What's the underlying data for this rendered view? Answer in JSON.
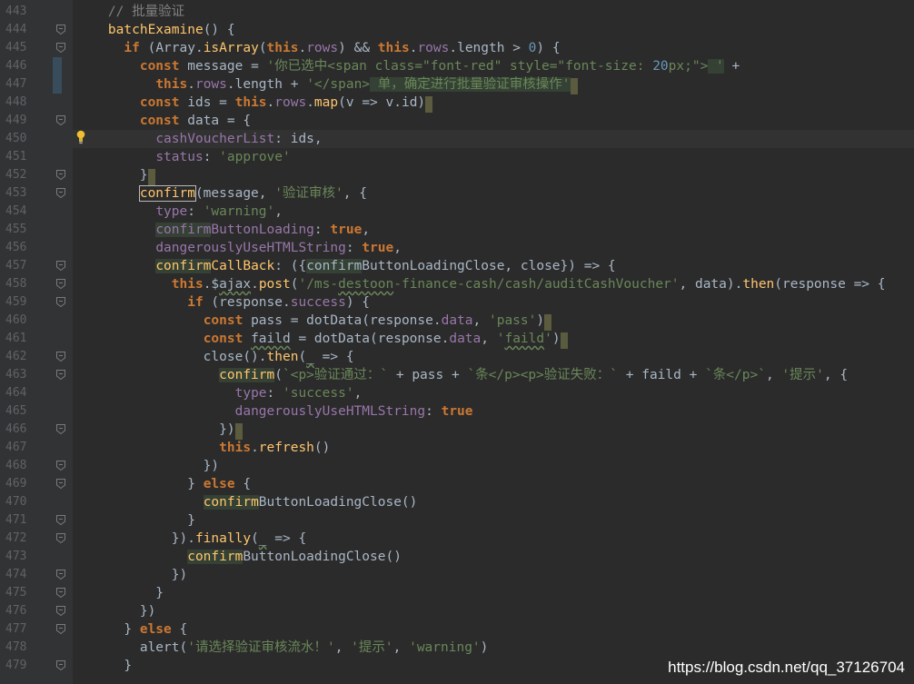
{
  "theme": {
    "background": "#2b2b2b",
    "gutter": "#313335",
    "keyword": "#cc7832",
    "string": "#6a8759",
    "function": "#ffc66d",
    "property": "#9876aa",
    "number": "#6897bb",
    "comment": "#808080",
    "text": "#a9b7c6"
  },
  "editor": {
    "current_line_index": 7,
    "lines": [
      {
        "num": "443",
        "fold": false,
        "tokens": [
          {
            "t": "    "
          },
          {
            "t": "// 批量验证",
            "c": "comment"
          }
        ]
      },
      {
        "num": "444",
        "fold": true,
        "tokens": [
          {
            "t": "    "
          },
          {
            "t": "batchExamine",
            "c": "fn"
          },
          {
            "t": "() {"
          }
        ]
      },
      {
        "num": "445",
        "fold": true,
        "tokens": [
          {
            "t": "      "
          },
          {
            "t": "if",
            "c": "kw"
          },
          {
            "t": " (Array."
          },
          {
            "t": "isArray",
            "c": "fn"
          },
          {
            "t": "("
          },
          {
            "t": "this",
            "c": "kw"
          },
          {
            "t": "."
          },
          {
            "t": "rows",
            "c": "prop"
          },
          {
            "t": ") && "
          },
          {
            "t": "this",
            "c": "kw"
          },
          {
            "t": "."
          },
          {
            "t": "rows",
            "c": "prop"
          },
          {
            "t": ".length > "
          },
          {
            "t": "0",
            "c": "num"
          },
          {
            "t": ") {"
          }
        ]
      },
      {
        "num": "446",
        "fold": false,
        "tokens": [
          {
            "t": "        "
          },
          {
            "t": "const",
            "c": "kw"
          },
          {
            "t": " message = "
          },
          {
            "t": "'你已选中<span class=\"font-red\" style=\"font-size: ",
            "c": "str"
          },
          {
            "t": "20",
            "c": "num"
          },
          {
            "t": "px;\">",
            "c": "str"
          },
          {
            "t": " '",
            "c": "str",
            "hl": true
          },
          {
            "t": " +"
          }
        ]
      },
      {
        "num": "447",
        "fold": false,
        "tokens": [
          {
            "t": "          "
          },
          {
            "t": "this",
            "c": "kw"
          },
          {
            "t": "."
          },
          {
            "t": "rows",
            "c": "prop"
          },
          {
            "t": ".length + "
          },
          {
            "t": "'</span>",
            "c": "str"
          },
          {
            "t": " 单，确定进行批量验证审核操作'",
            "c": "str",
            "hl": true
          },
          {
            "t": " ",
            "caret": true
          }
        ]
      },
      {
        "num": "448",
        "fold": false,
        "tokens": [
          {
            "t": "        "
          },
          {
            "t": "const",
            "c": "kw"
          },
          {
            "t": " ids = "
          },
          {
            "t": "this",
            "c": "kw"
          },
          {
            "t": "."
          },
          {
            "t": "rows",
            "c": "prop"
          },
          {
            "t": "."
          },
          {
            "t": "map",
            "c": "fn"
          },
          {
            "t": "(v => v.id)"
          },
          {
            "t": " ",
            "caret": true
          }
        ]
      },
      {
        "num": "449",
        "fold": true,
        "tokens": [
          {
            "t": "        "
          },
          {
            "t": "const",
            "c": "kw"
          },
          {
            "t": " data = {"
          }
        ]
      },
      {
        "num": "450",
        "fold": false,
        "bulb": true,
        "tokens": [
          {
            "t": "          "
          },
          {
            "t": "cashVoucherList",
            "c": "prop"
          },
          {
            "t": ": ids,"
          }
        ]
      },
      {
        "num": "451",
        "fold": false,
        "tokens": [
          {
            "t": "          "
          },
          {
            "t": "status",
            "c": "prop"
          },
          {
            "t": ": "
          },
          {
            "t": "'approve'",
            "c": "str"
          }
        ]
      },
      {
        "num": "452",
        "fold": true,
        "tokens": [
          {
            "t": "        }"
          },
          {
            "t": " ",
            "caret": true
          }
        ]
      },
      {
        "num": "453",
        "fold": true,
        "tokens": [
          {
            "t": "        "
          },
          {
            "t": "confirm",
            "c": "fn",
            "box": true
          },
          {
            "t": "(message, "
          },
          {
            "t": "'验证审核'",
            "c": "str"
          },
          {
            "t": ", {"
          }
        ]
      },
      {
        "num": "454",
        "fold": false,
        "tokens": [
          {
            "t": "          "
          },
          {
            "t": "type",
            "c": "prop"
          },
          {
            "t": ": "
          },
          {
            "t": "'warning'",
            "c": "str"
          },
          {
            "t": ","
          }
        ]
      },
      {
        "num": "455",
        "fold": false,
        "tokens": [
          {
            "t": "          "
          },
          {
            "t": "confirm",
            "c": "prop",
            "hl": true
          },
          {
            "t": "ButtonLoading",
            "c": "prop"
          },
          {
            "t": ": "
          },
          {
            "t": "true",
            "c": "kw"
          },
          {
            "t": ","
          }
        ]
      },
      {
        "num": "456",
        "fold": false,
        "tokens": [
          {
            "t": "          "
          },
          {
            "t": "dangerouslyUseHTMLString",
            "c": "prop"
          },
          {
            "t": ": "
          },
          {
            "t": "true",
            "c": "kw"
          },
          {
            "t": ","
          }
        ]
      },
      {
        "num": "457",
        "fold": true,
        "tokens": [
          {
            "t": "          "
          },
          {
            "t": "confirm",
            "c": "fn",
            "hl": true
          },
          {
            "t": "CallBack",
            "c": "fn"
          },
          {
            "t": ": ({"
          },
          {
            "t": "confirm",
            "hl": true
          },
          {
            "t": "ButtonLoadingClose, close}) => {"
          }
        ]
      },
      {
        "num": "458",
        "fold": true,
        "tokens": [
          {
            "t": "            "
          },
          {
            "t": "this",
            "c": "kw"
          },
          {
            "t": ".$"
          },
          {
            "t": "ajax",
            "squig": true
          },
          {
            "t": "."
          },
          {
            "t": "post",
            "c": "fn"
          },
          {
            "t": "("
          },
          {
            "t": "'/ms-",
            "c": "str"
          },
          {
            "t": "destoon",
            "c": "str",
            "squig": true
          },
          {
            "t": "-finance-cash/cash/auditCashVoucher'",
            "c": "str"
          },
          {
            "t": ", data)."
          },
          {
            "t": "then",
            "c": "fn"
          },
          {
            "t": "(response => {"
          }
        ]
      },
      {
        "num": "459",
        "fold": true,
        "tokens": [
          {
            "t": "              "
          },
          {
            "t": "if",
            "c": "kw"
          },
          {
            "t": " (response."
          },
          {
            "t": "success",
            "c": "prop"
          },
          {
            "t": ") {"
          }
        ]
      },
      {
        "num": "460",
        "fold": false,
        "tokens": [
          {
            "t": "                "
          },
          {
            "t": "const",
            "c": "kw"
          },
          {
            "t": " pass = dotData(response."
          },
          {
            "t": "data",
            "c": "prop"
          },
          {
            "t": ", "
          },
          {
            "t": "'pass'",
            "c": "str"
          },
          {
            "t": ")"
          },
          {
            "t": " ",
            "caret": true
          }
        ]
      },
      {
        "num": "461",
        "fold": false,
        "tokens": [
          {
            "t": "                "
          },
          {
            "t": "const",
            "c": "kw"
          },
          {
            "t": " "
          },
          {
            "t": "faild",
            "squig": true
          },
          {
            "t": " = dotData(response."
          },
          {
            "t": "data",
            "c": "prop"
          },
          {
            "t": ", "
          },
          {
            "t": "'",
            "c": "str"
          },
          {
            "t": "faild",
            "c": "str",
            "squig": true
          },
          {
            "t": "'",
            "c": "str"
          },
          {
            "t": ")"
          },
          {
            "t": " ",
            "caret": true
          }
        ]
      },
      {
        "num": "462",
        "fold": true,
        "tokens": [
          {
            "t": "                close()."
          },
          {
            "t": "then",
            "c": "fn"
          },
          {
            "t": "("
          },
          {
            "t": "_",
            "squig": true
          },
          {
            "t": " => {"
          }
        ]
      },
      {
        "num": "463",
        "fold": true,
        "tokens": [
          {
            "t": "                  "
          },
          {
            "t": "confirm",
            "c": "fn",
            "hl": true
          },
          {
            "t": "("
          },
          {
            "t": "`<p>验证通过：`",
            "c": "str"
          },
          {
            "t": " + pass + "
          },
          {
            "t": "`条</p><p>验证失败：`",
            "c": "str"
          },
          {
            "t": " + faild + "
          },
          {
            "t": "`条</p>`",
            "c": "str"
          },
          {
            "t": ", "
          },
          {
            "t": "'提示'",
            "c": "str"
          },
          {
            "t": ", {"
          }
        ]
      },
      {
        "num": "464",
        "fold": false,
        "tokens": [
          {
            "t": "                    "
          },
          {
            "t": "type",
            "c": "prop"
          },
          {
            "t": ": "
          },
          {
            "t": "'success'",
            "c": "str"
          },
          {
            "t": ","
          }
        ]
      },
      {
        "num": "465",
        "fold": false,
        "tokens": [
          {
            "t": "                    "
          },
          {
            "t": "dangerouslyUseHTMLString",
            "c": "prop"
          },
          {
            "t": ": "
          },
          {
            "t": "true",
            "c": "kw"
          }
        ]
      },
      {
        "num": "466",
        "fold": true,
        "tokens": [
          {
            "t": "                  })"
          },
          {
            "t": " ",
            "caret": true
          }
        ]
      },
      {
        "num": "467",
        "fold": false,
        "tokens": [
          {
            "t": "                  "
          },
          {
            "t": "this",
            "c": "kw"
          },
          {
            "t": "."
          },
          {
            "t": "refresh",
            "c": "fn"
          },
          {
            "t": "()"
          }
        ]
      },
      {
        "num": "468",
        "fold": true,
        "tokens": [
          {
            "t": "                })"
          }
        ]
      },
      {
        "num": "469",
        "fold": true,
        "tokens": [
          {
            "t": "              } "
          },
          {
            "t": "else",
            "c": "kw"
          },
          {
            "t": " {"
          }
        ]
      },
      {
        "num": "470",
        "fold": false,
        "tokens": [
          {
            "t": "                "
          },
          {
            "t": "confirm",
            "c": "fn",
            "hl": true
          },
          {
            "t": "ButtonLoadingClose()"
          }
        ]
      },
      {
        "num": "471",
        "fold": true,
        "tokens": [
          {
            "t": "              }"
          }
        ]
      },
      {
        "num": "472",
        "fold": true,
        "tokens": [
          {
            "t": "            })."
          },
          {
            "t": "finally",
            "c": "fn"
          },
          {
            "t": "("
          },
          {
            "t": "_",
            "squig": true
          },
          {
            "t": " => {"
          }
        ]
      },
      {
        "num": "473",
        "fold": false,
        "tokens": [
          {
            "t": "              "
          },
          {
            "t": "confirm",
            "c": "fn",
            "hl": true
          },
          {
            "t": "ButtonLoadingClose()"
          }
        ]
      },
      {
        "num": "474",
        "fold": true,
        "tokens": [
          {
            "t": "            })"
          }
        ]
      },
      {
        "num": "475",
        "fold": true,
        "tokens": [
          {
            "t": "          }"
          }
        ]
      },
      {
        "num": "476",
        "fold": true,
        "tokens": [
          {
            "t": "        })"
          }
        ]
      },
      {
        "num": "477",
        "fold": true,
        "tokens": [
          {
            "t": "      } "
          },
          {
            "t": "else",
            "c": "kw"
          },
          {
            "t": " {"
          }
        ]
      },
      {
        "num": "478",
        "fold": false,
        "tokens": [
          {
            "t": "        alert("
          },
          {
            "t": "'请选择验证审核流水！'",
            "c": "str"
          },
          {
            "t": ", "
          },
          {
            "t": "'提示'",
            "c": "str"
          },
          {
            "t": ", "
          },
          {
            "t": "'warning'",
            "c": "str"
          },
          {
            "t": ")"
          }
        ]
      },
      {
        "num": "479",
        "fold": true,
        "tokens": [
          {
            "t": "      }"
          }
        ]
      }
    ]
  },
  "watermark": "https://blog.csdn.net/qq_37126704"
}
